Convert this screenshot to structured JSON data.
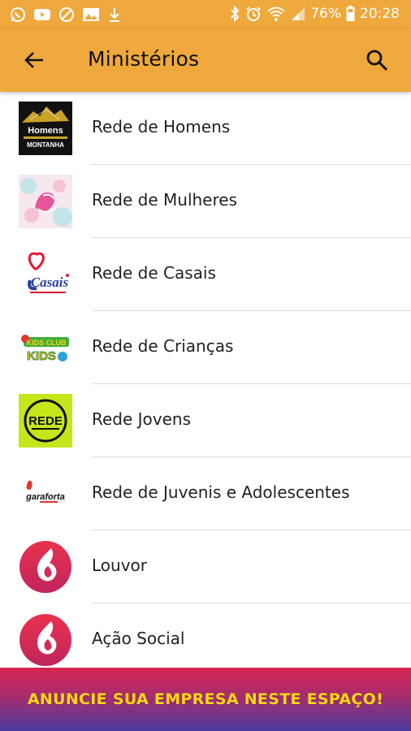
{
  "status_bar": {
    "battery": "76%",
    "time": "20:28",
    "left_icons": [
      "whatsapp-icon",
      "youtube-icon",
      "block-icon",
      "gallery-icon",
      "download-icon"
    ],
    "right_icons": [
      "bluetooth-icon",
      "alarm-icon",
      "wifi-icon",
      "signal-icon",
      "battery-icon"
    ]
  },
  "app_bar": {
    "title": "Ministérios",
    "back_icon": "arrow-left-icon",
    "search_icon": "search-icon",
    "color": "#EEA83C"
  },
  "ministries": [
    {
      "label": "Rede de Homens",
      "thumb": "homens-logo"
    },
    {
      "label": "Rede de Mulheres",
      "thumb": "mulheres-logo"
    },
    {
      "label": "Rede de Casais",
      "thumb": "casais-logo"
    },
    {
      "label": "Rede de Crianças",
      "thumb": "kids-logo"
    },
    {
      "label": "Rede Jovens",
      "thumb": "rede-jovens-logo"
    },
    {
      "label": "Rede de Juvenis e Adolescentes",
      "thumb": "garaforta-logo"
    },
    {
      "label": "Louvor",
      "thumb": "flame-logo"
    },
    {
      "label": "Ação Social",
      "thumb": "flame-logo"
    }
  ],
  "thumb_text": {
    "homens_line1": "Homens",
    "homens_line2": "MONTANHA",
    "casais": "Casais",
    "kids": "KIDS",
    "rede": "REDE",
    "garaforta": "garaforta"
  },
  "ad_banner": {
    "text": "ANUNCIE SUA EMPRESA NESTE ESPAÇO!",
    "text_color": "#FFD814"
  }
}
